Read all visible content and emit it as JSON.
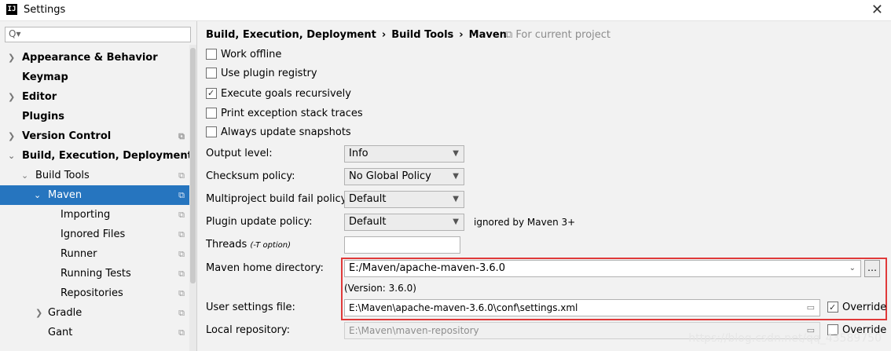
{
  "window": {
    "title": "Settings",
    "app_icon": "IJ"
  },
  "search": {
    "placeholder": "Q▾"
  },
  "tree": [
    {
      "label": "Appearance & Behavior"
    },
    {
      "label": "Keymap"
    },
    {
      "label": "Editor"
    },
    {
      "label": "Plugins"
    },
    {
      "label": "Version Control"
    },
    {
      "label": "Build, Execution, Deployment"
    },
    {
      "label": "Build Tools"
    },
    {
      "label": "Maven"
    },
    {
      "label": "Importing"
    },
    {
      "label": "Ignored Files"
    },
    {
      "label": "Runner"
    },
    {
      "label": "Running Tests"
    },
    {
      "label": "Repositories"
    },
    {
      "label": "Gradle"
    },
    {
      "label": "Gant"
    }
  ],
  "breadcrumb": {
    "level1": "Build, Execution, Deployment",
    "level2": "Build Tools",
    "level3": "Maven",
    "scope": "For current project"
  },
  "options": {
    "work_offline": "Work offline",
    "use_plugin_registry": "Use plugin registry",
    "execute_goals": "Execute goals recursively",
    "print_exception": "Print exception stack traces",
    "always_update": "Always update snapshots"
  },
  "fields": {
    "output_level_label": "Output level:",
    "output_level_value": "Info",
    "checksum_label": "Checksum policy:",
    "checksum_value": "No Global Policy",
    "multiproject_label": "Multiproject build fail policy:",
    "multiproject_value": "Default",
    "plugin_update_label": "Plugin update policy:",
    "plugin_update_value": "Default",
    "plugin_update_note": "ignored by Maven 3+",
    "threads_label": "Threads",
    "threads_note": "(-T option)",
    "maven_home_label": "Maven home directory:",
    "maven_home_value": "E:/Maven/apache-maven-3.6.0",
    "maven_version": "(Version: 3.6.0)",
    "user_settings_label": "User settings file:",
    "user_settings_value": "E:\\Maven\\apache-maven-3.6.0\\conf\\settings.xml",
    "local_repo_label": "Local repository:",
    "local_repo_value": "E:\\Maven\\maven-repository",
    "override": "Override"
  },
  "watermark": "https://blog.csdn.net/qq_43589750"
}
